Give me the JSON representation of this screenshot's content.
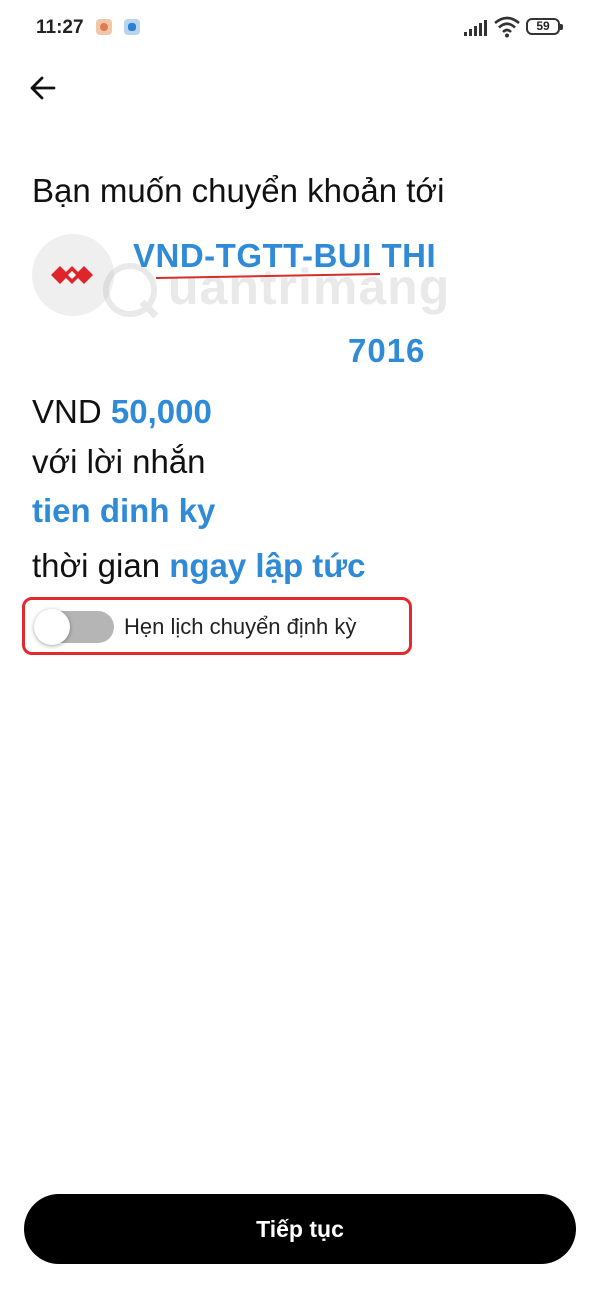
{
  "status_bar": {
    "time": "11:27",
    "battery": "59",
    "app_icons": [
      "photo-app-icon",
      "messenger-app-icon"
    ]
  },
  "header": {
    "back_icon": "arrow-left-icon"
  },
  "transfer": {
    "title": "Bạn muốn chuyển khoản tới",
    "bank_logo_icon": "bank-logo-icon",
    "recipient_name": "VND-TGTT-BUI THI",
    "account_number": "7016",
    "currency": "VND",
    "amount": "50,000",
    "message_label": "với lời nhắn",
    "message": "tien dinh ky",
    "time_label": "thời gian",
    "time_value": "ngay lập tức"
  },
  "schedule": {
    "label": "Hẹn lịch chuyển định kỳ",
    "enabled": false
  },
  "watermark": {
    "text": "uantrimang"
  },
  "actions": {
    "continue_label": "Tiếp tục"
  },
  "colors": {
    "accent": "#2f8ad8",
    "highlight": "#e3282e",
    "button": "#000000",
    "bank_red": "#e0242b"
  }
}
